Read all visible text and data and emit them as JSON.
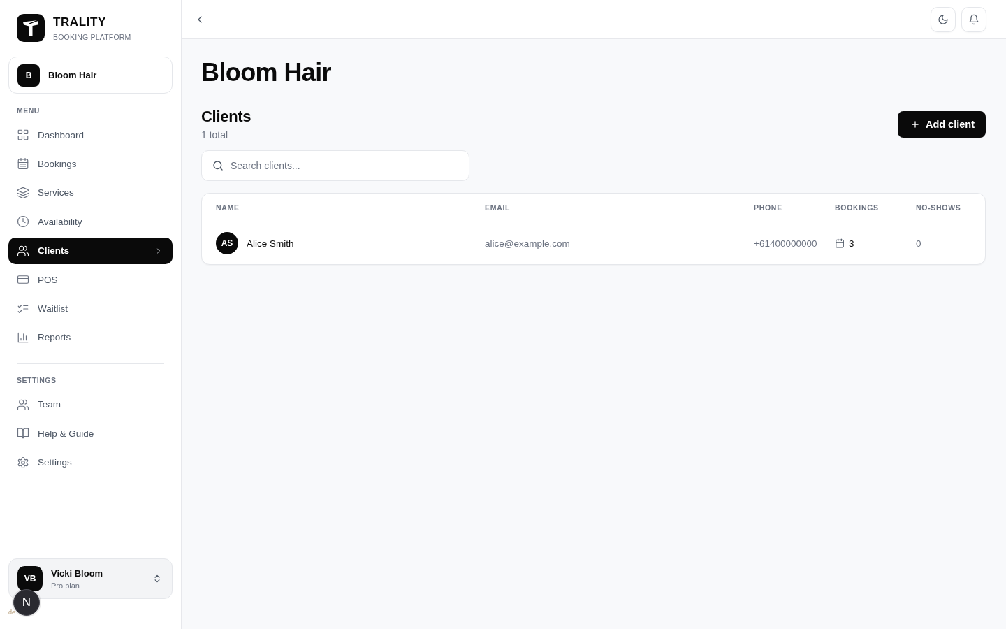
{
  "brand": {
    "name": "TRALITY",
    "tagline": "BOOKING PLATFORM"
  },
  "business": {
    "initial": "B",
    "name": "Bloom Hair"
  },
  "nav_sections": [
    {
      "title": "MENU",
      "items": [
        {
          "label": "Dashboard",
          "selected": false
        },
        {
          "label": "Bookings",
          "selected": false
        },
        {
          "label": "Services",
          "selected": false
        },
        {
          "label": "Availability",
          "selected": false
        },
        {
          "label": "Clients",
          "selected": true
        },
        {
          "label": "POS",
          "selected": false
        },
        {
          "label": "Waitlist",
          "selected": false
        },
        {
          "label": "Reports",
          "selected": false
        }
      ]
    },
    {
      "title": "SETTINGS",
      "items": [
        {
          "label": "Team",
          "selected": false
        },
        {
          "label": "Help & Guide",
          "selected": false
        },
        {
          "label": "Settings",
          "selected": false
        }
      ]
    }
  ],
  "user": {
    "initials": "VB",
    "name": "Vicki Bloom",
    "plan": "Pro plan"
  },
  "dev_indicator": {
    "label": "N",
    "caption": "de"
  },
  "page": {
    "title": "Bloom Hair",
    "section_title": "Clients",
    "count": "1 total",
    "add_button": "Add client",
    "search": {
      "placeholder": "Search clients..."
    }
  },
  "table": {
    "columns": [
      "NAME",
      "EMAIL",
      "PHONE",
      "BOOKINGS",
      "NO-SHOWS"
    ],
    "rows": [
      {
        "initials": "AS",
        "name": "Alice Smith",
        "email": "alice@example.com",
        "phone": "+61400000000",
        "bookings": "3",
        "no_shows": "0"
      }
    ]
  }
}
